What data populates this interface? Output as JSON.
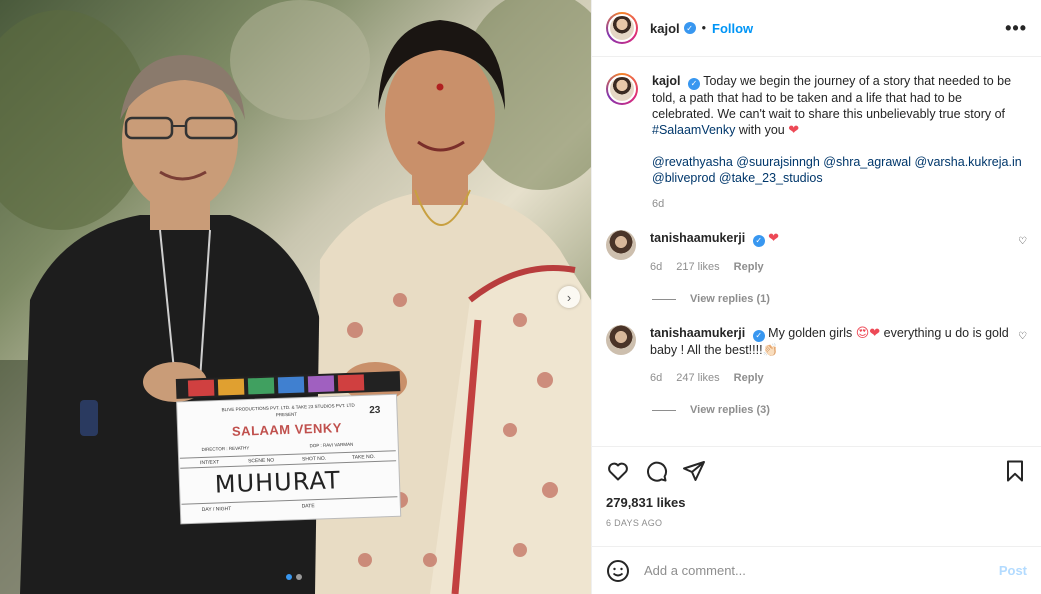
{
  "post": {
    "username": "kajol",
    "follow_label": "Follow",
    "separator": "•",
    "more_label": "•••",
    "image_overlay": {
      "clapper_company": "BLIVE PRODUCTIONS PVT. LTD. & TAKE 23 STUDIOS PVT. LTD",
      "clapper_presents": "PRESENT",
      "clapper_title": "SALAAM VENKY",
      "clapper_director": "DIRECTOR : REVATHY",
      "clapper_dop": "DOP : RAVI VARMAN",
      "clapper_number": "23",
      "clapper_int_ext": "INT/EXT",
      "clapper_scene": "SCENE NO",
      "clapper_shot": "SHOT NO.",
      "clapper_take": "TAKE NO.",
      "clapper_handwritten": "MUHURAT",
      "clapper_day_night": "DAY / NIGHT",
      "clapper_date": "DATE"
    }
  },
  "caption": {
    "username": "kajol",
    "text": "Today we begin the journey of a story that needed to be told, a path that had to be taken and a life that had to be celebrated. We can't wait to share this unbelievably true story of",
    "hashtag": "#SalaamVenky",
    "text_after": " with you ",
    "heart": "❤",
    "mentions_line1": "@revathyasha @suurajsinngh @shra_agrawal @varsha.kukreja.in",
    "mentions_line2": "@bliveprod @take_23_studios",
    "time": "6d"
  },
  "comments": [
    {
      "username": "tanishaamukerji",
      "text": "",
      "emoji": "❤",
      "time": "6d",
      "likes": "217 likes",
      "reply_label": "Reply",
      "view_replies": "View replies (1)"
    },
    {
      "username": "tanishaamukerji",
      "text_part1": "My golden girls ",
      "emoji_mid": "😍❤",
      "text_part2": " everything u do is gold baby ! All the best!!!!",
      "emoji_end": "👏🏻",
      "time": "6d",
      "likes": "247 likes",
      "reply_label": "Reply",
      "view_replies": "View replies (3)"
    }
  ],
  "actions": {
    "likes": "279,831 likes",
    "date": "6 DAYS AGO"
  },
  "add_comment": {
    "placeholder": "Add a comment...",
    "post_label": "Post"
  },
  "colors": {
    "accent": "#0095f6",
    "verified": "#3897f0",
    "heart": "#ed4956",
    "muted": "#8e8e8e"
  }
}
